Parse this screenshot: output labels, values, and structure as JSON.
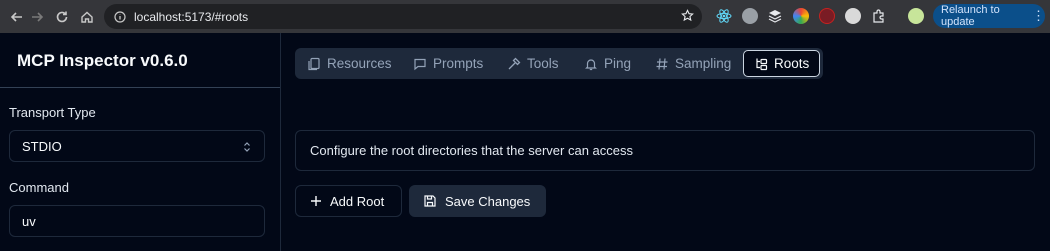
{
  "browser": {
    "url": "localhost:5173/#roots",
    "relaunch_label": "Relaunch to update"
  },
  "sidebar": {
    "title": "MCP Inspector v0.6.0",
    "transport_label": "Transport Type",
    "transport_value": "STDIO",
    "command_label": "Command",
    "command_value": "uv"
  },
  "tabs": [
    {
      "label": "Resources",
      "icon": "files-icon"
    },
    {
      "label": "Prompts",
      "icon": "message-square-icon"
    },
    {
      "label": "Tools",
      "icon": "hammer-icon"
    },
    {
      "label": "Ping",
      "icon": "bell-icon"
    },
    {
      "label": "Sampling",
      "icon": "hash-icon"
    },
    {
      "label": "Roots",
      "icon": "folder-tree-icon",
      "active": true
    }
  ],
  "roots": {
    "description": "Configure the root directories that the server can access",
    "add_label": "Add Root",
    "save_label": "Save Changes"
  },
  "colors": {
    "background": "#020817",
    "muted": "#1e293b",
    "relaunch": "#0b4f8a"
  }
}
